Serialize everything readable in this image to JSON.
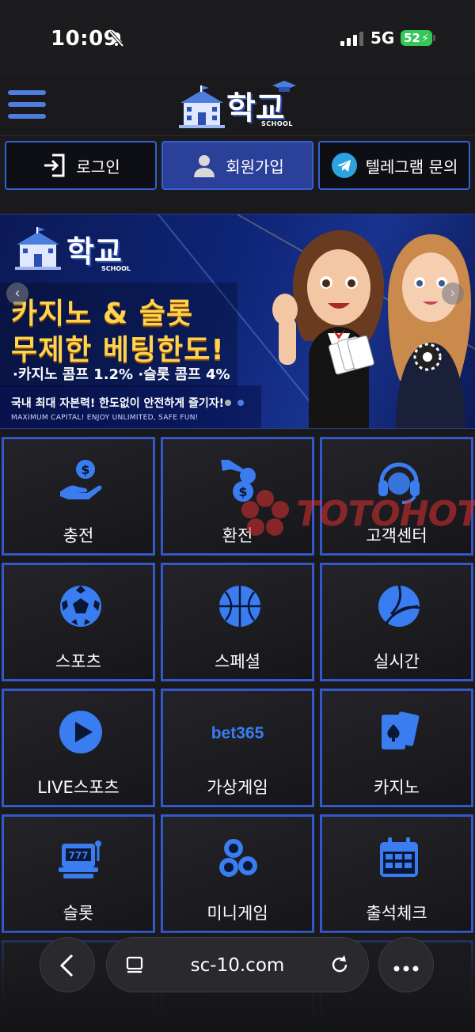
{
  "status": {
    "time": "10:09",
    "network": "5G",
    "battery": "52"
  },
  "header": {
    "logo_text": "학교",
    "logo_sub": "SCHOOL"
  },
  "actions": [
    {
      "label": "로그인",
      "icon": "login-icon",
      "active": false
    },
    {
      "label": "회원가입",
      "icon": "user-icon",
      "active": true
    },
    {
      "label": "텔레그램 문의",
      "icon": "telegram-icon",
      "active": false
    }
  ],
  "banner": {
    "logo_text": "학교",
    "logo_sub": "SCHOOL",
    "headline1": "카지노 & 슬롯",
    "headline2": "무제한 베팅한도!",
    "commission": "·카지노 콤프 1.2%  ·슬롯 콤프 4%",
    "line1": "국내 최대 자본력! 한도없이 안전하게 즐기자!",
    "line2": "MAXIMUM CAPITAL! ENJOY UNLIMITED, SAFE FUN!"
  },
  "menu": [
    {
      "label": "충전",
      "icon": "money-hand-icon"
    },
    {
      "label": "환전",
      "icon": "exchange-icon"
    },
    {
      "label": "고객센터",
      "icon": "headset-icon"
    },
    {
      "label": "스포츠",
      "icon": "soccer-ball-icon"
    },
    {
      "label": "스페셜",
      "icon": "basketball-icon"
    },
    {
      "label": "실시간",
      "icon": "volleyball-icon"
    },
    {
      "label": "LIVE스포츠",
      "icon": "play-icon"
    },
    {
      "label": "가상게임",
      "icon": "bet365-icon",
      "icon_text": "bet365"
    },
    {
      "label": "카지노",
      "icon": "cards-icon"
    },
    {
      "label": "슬롯",
      "icon": "slot-machine-icon",
      "icon_text": "777"
    },
    {
      "label": "미니게임",
      "icon": "lottery-balls-icon"
    },
    {
      "label": "출석체크",
      "icon": "calendar-icon"
    }
  ],
  "watermark": {
    "text": "TOTOHOT"
  },
  "browser": {
    "url": "sc-10.com"
  },
  "colors": {
    "accent": "#3358c9",
    "gold": "#ffd34d",
    "icon_blue": "#3a7df0"
  }
}
